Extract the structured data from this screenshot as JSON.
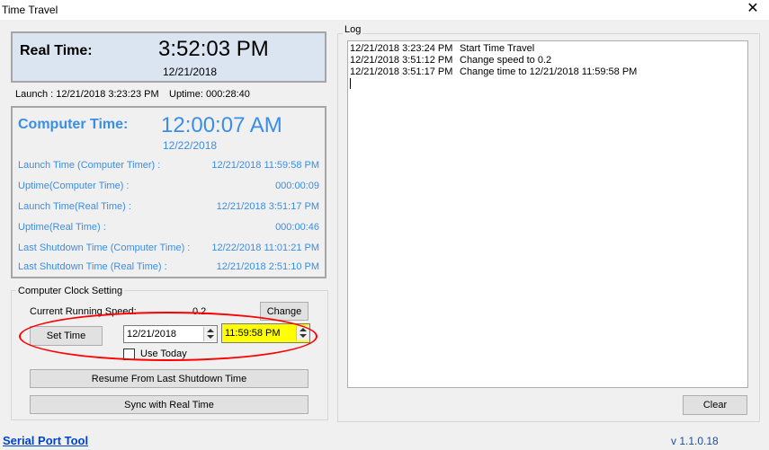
{
  "window": {
    "title": "Time Travel",
    "close_glyph": "✕"
  },
  "real_time": {
    "label": "Real Time:",
    "time": "3:52:03 PM",
    "date": "12/21/2018",
    "launch": "Launch : 12/21/2018 3:23:23 PM",
    "uptime": "Uptime: 000:28:40"
  },
  "computer_time": {
    "label": "Computer Time:",
    "time": "12:00:07 AM",
    "date": "12/22/2018",
    "rows": [
      {
        "label": "Launch Time (Computer Timer) :",
        "value": "12/21/2018 11:59:58 PM"
      },
      {
        "label": "Uptime(Computer Time) :",
        "value": "000:00:09"
      },
      {
        "label": "Launch Time(Real Time) :",
        "value": "12/21/2018 3:51:17 PM"
      },
      {
        "label": "Uptime(Real Time) :",
        "value": "000:00:46"
      },
      {
        "label": "Last Shutdown Time (Computer Time) :",
        "value": "12/22/2018 11:01:21 PM"
      },
      {
        "label": "Last Shutdown Time (Real Time) :",
        "value": "12/21/2018 2:51:10 PM"
      }
    ]
  },
  "clock_setting": {
    "group_title": "Computer Clock Setting",
    "speed_label": "Current Running Speed:",
    "speed_value": "0.2",
    "change_button": "Change",
    "set_time_button": "Set Time",
    "date_value": "12/21/2018",
    "time_value": "11:59:58 PM",
    "use_today_label": "Use Today",
    "use_today_checked": false,
    "resume_button": "Resume From Last Shutdown Time",
    "sync_button": "Sync with Real Time",
    "highlight_color": "#ffff00",
    "annotation_color": "#ff0000"
  },
  "log": {
    "title": "Log",
    "entries": [
      {
        "time": "12/21/2018 3:23:24 PM",
        "text": "Start Time Travel"
      },
      {
        "time": "12/21/2018 3:51:12 PM",
        "text": "Change speed to 0.2"
      },
      {
        "time": "12/21/2018 3:51:17 PM",
        "text": "Change time to 12/21/2018 11:59:58 PM"
      }
    ],
    "clear_button": "Clear"
  },
  "footer": {
    "link": "Serial Port Tool",
    "version": "v 1.1.0.18"
  },
  "colors": {
    "accent_blue": "#3a8ee6",
    "real_panel_bg": "#dbe5f1"
  }
}
